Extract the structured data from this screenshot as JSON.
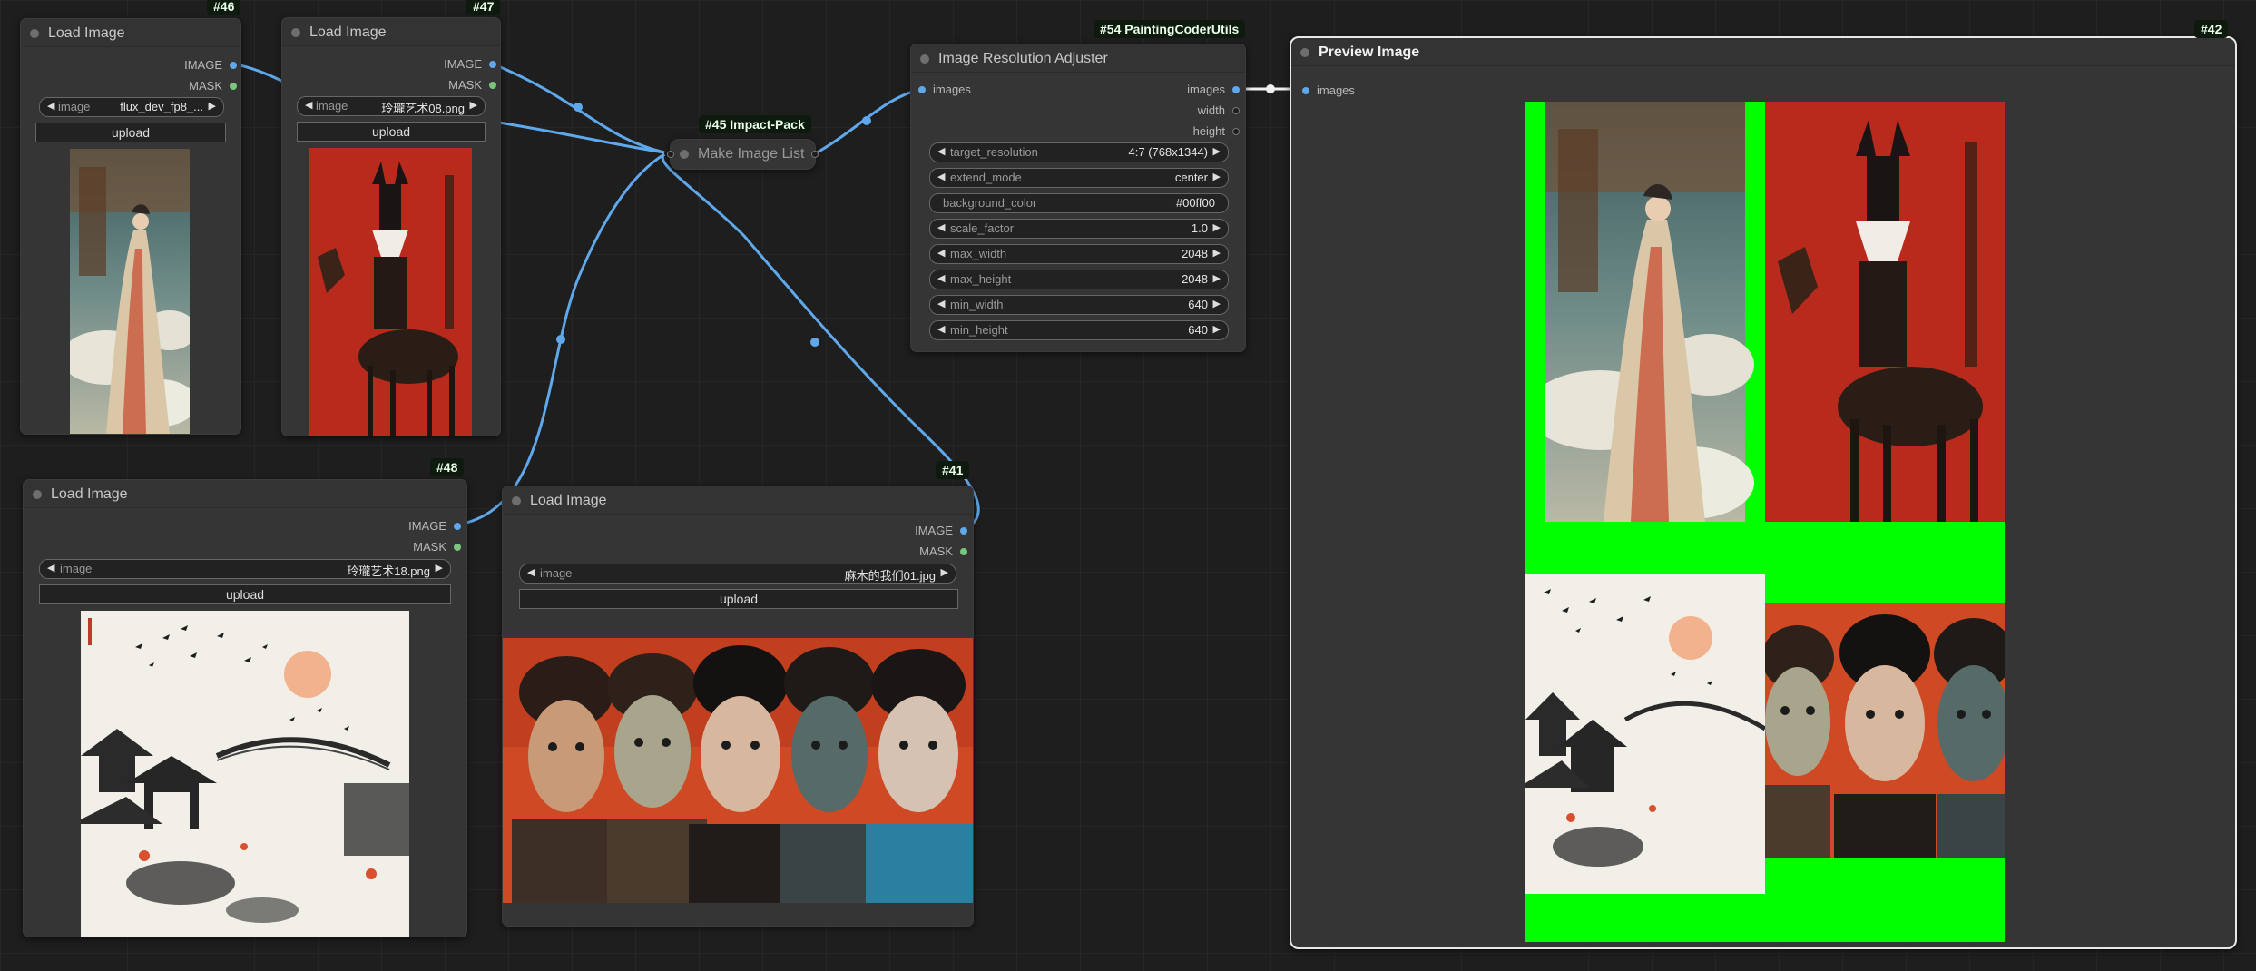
{
  "nodes": {
    "n46": {
      "id": "#46",
      "title": "Load Image",
      "out_image": "IMAGE",
      "out_mask": "MASK",
      "widget_name": "image",
      "widget_value": "flux_dev_fp8_...",
      "upload": "upload"
    },
    "n47": {
      "id": "#47",
      "title": "Load Image",
      "out_image": "IMAGE",
      "out_mask": "MASK",
      "widget_name": "image",
      "widget_value": "玲瓏艺术08.png",
      "upload": "upload"
    },
    "n48": {
      "id": "#48",
      "title": "Load Image",
      "out_image": "IMAGE",
      "out_mask": "MASK",
      "widget_name": "image",
      "widget_value": "玲瓏艺术18.png",
      "upload": "upload"
    },
    "n41": {
      "id": "#41",
      "title": "Load Image",
      "out_image": "IMAGE",
      "out_mask": "MASK",
      "widget_name": "image",
      "widget_value": "麻木的我们01.jpg",
      "upload": "upload"
    },
    "n45": {
      "id": "#45 Impact-Pack",
      "title": "Make Image List"
    },
    "n54": {
      "id": "#54 PaintingCoderUtils",
      "title": "Image Resolution Adjuster",
      "in_images": "images",
      "out_images": "images",
      "out_width": "width",
      "out_height": "height",
      "widgets": [
        {
          "name": "target_resolution",
          "value": "4:7 (768x1344)"
        },
        {
          "name": "extend_mode",
          "value": "center"
        },
        {
          "name": "background_color",
          "value": "#00ff00"
        },
        {
          "name": "scale_factor",
          "value": "1.0"
        },
        {
          "name": "max_width",
          "value": "2048"
        },
        {
          "name": "max_height",
          "value": "2048"
        },
        {
          "name": "min_width",
          "value": "640"
        },
        {
          "name": "min_height",
          "value": "640"
        }
      ]
    },
    "n42": {
      "id": "#42",
      "title": "Preview Image",
      "in_images": "images"
    }
  },
  "colors": {
    "wire": "#5fa8ec",
    "padding_green": "#00ff00",
    "badge_bg": "#0f1a0f",
    "node_bg": "#353535"
  },
  "icons": {
    "collapse": "circle-dot-icon",
    "widget_left": "triangle-left-icon",
    "widget_right": "triangle-right-icon"
  }
}
